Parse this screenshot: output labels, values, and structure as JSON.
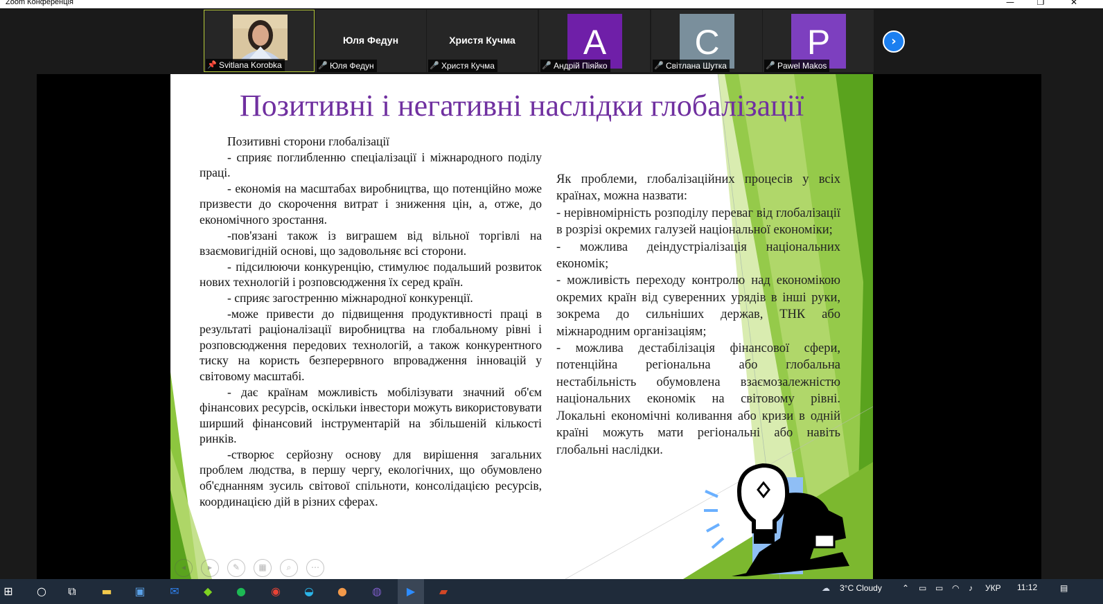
{
  "window": {
    "title": "Zoom Конференція",
    "controls": {
      "minimize": "—",
      "maximize": "❐",
      "close": "✕"
    }
  },
  "participants": [
    {
      "name": "Svitlana Korobka",
      "status_icon": "pin-icon",
      "video": "photo",
      "active": true
    },
    {
      "name": "Юля Федун",
      "display_name": "Юля Федун",
      "status_icon": "mic-muted-icon"
    },
    {
      "name": "Христя Кучма",
      "display_name": "Христя Кучма",
      "status_icon": "mic-muted-icon"
    },
    {
      "name": "Андрій Піяйко",
      "initial": "A",
      "avatar_color": "#6f1fa8",
      "status_icon": "mic-muted-icon"
    },
    {
      "name": "Світлана Шутка",
      "initial": "C",
      "avatar_color": "#7a8f9c",
      "status_icon": "mic-muted-icon"
    },
    {
      "name": "Pawel Makos",
      "initial": "P",
      "avatar_color": "#7d3fbf",
      "status_icon": "mic-muted-icon"
    }
  ],
  "next_page_icon": "chevron-right-icon",
  "slide": {
    "title": "Позитивні і негативні наслідки глобалізації",
    "left_heading": "Позитивні сторони глобалізації",
    "left_items": [
      "- сприяє поглибленню спеціалізації і міжнародного поділу праці.",
      "- економія на масштабах виробництва, що потенційно може призвести до скорочення витрат і зниження цін, а, отже, до економічного зростання.",
      "-пов'язані також із виграшем від вільної торгівлі на взаємовигідній основі, що задовольняє всі сторони.",
      "- підсилюючи конкуренцію, стимулює подальший розвиток нових технологій і розповсюдження їх серед країн.",
      "- сприяє загостренню міжнародної конкуренції.",
      "-може привести до підвищення продуктивності праці в результаті раціоналізації виробництва на глобальному рівні і розповсюдження передових технологій, а також конкурентного тиску на користь безперервного впровадження інновацій у світовому масштабі.",
      "- дає країнам можливість мобілізувати значний об'єм фінансових ресурсів, оскільки інвестори можуть використовувати ширший фінансовий інструментарій на збільшеній кількості ринків.",
      "-створює серйозну основу для вирішення загальних проблем людства, в першу чергу, екологічних, що обумовлено об'єднанням зусиль світової спільноти, консолідацією ресурсів, координацією дій в різних сферах."
    ],
    "right_intro": "Як проблеми, глобалізаційних процесів у всіх країнах, можна назвати:",
    "right_items": [
      "- нерівномірність розподілу переваг від глобалізації в розрізі окремих галузей національної економіки;",
      "- можлива деіндустріалізація національних економік;",
      "- можливість переходу контролю над економікою окремих країн від суверенних урядів в інші руки, зокрема до сильніших держав, ТНК або міжнародним організаціям;",
      "- можлива дестабілізація фінансової сфери, потенційна регіональна або глобальна нестабільність обумовлена взаємозалежністю національних економік на світовому рівні. Локальні економічні коливання або кризи в одній країні можуть мати регіональні або навіть глобальні наслідки."
    ],
    "toolbar_icons": [
      "prev-slide-icon",
      "next-slide-icon",
      "pen-icon",
      "slides-grid-icon",
      "zoom-icon",
      "more-icon"
    ],
    "colors": {
      "title": "#7030a0",
      "accent_green": "#8dc63f",
      "light_green": "#c5e08a"
    }
  },
  "taskbar": {
    "icons": [
      "windows-start-icon",
      "search-icon",
      "task-view-icon",
      "file-explorer-icon",
      "store-icon",
      "mail-icon",
      "app-icon",
      "spotify-icon",
      "chrome-icon",
      "edge-icon",
      "app2-icon",
      "viber-icon",
      "zoom-icon",
      "powerpoint-icon"
    ],
    "weather": "3°C  Cloudy",
    "language": "УКР",
    "time": "11:12",
    "notifications_icon": "notification-icon"
  }
}
